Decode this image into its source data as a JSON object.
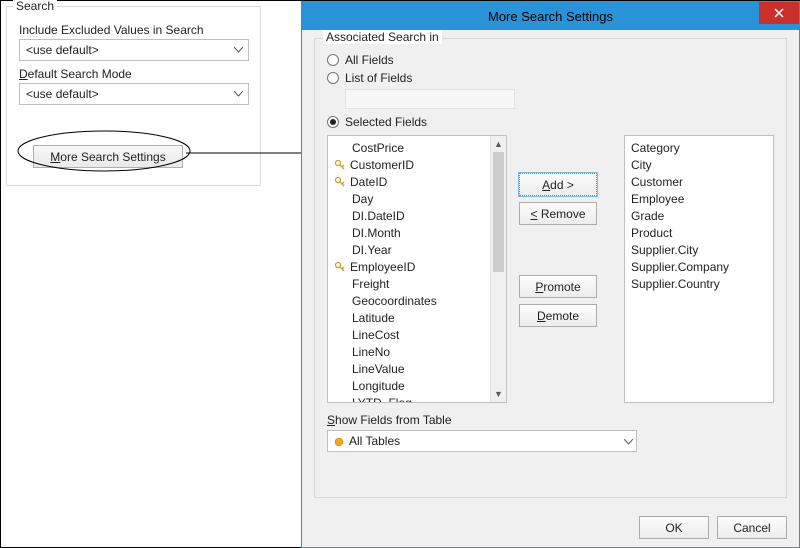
{
  "left": {
    "group_title": "Search",
    "include_label": "Include Excluded Values in Search",
    "include_value": "<use default>",
    "default_mode_label": "Default Search Mode",
    "default_mode_value": "<use default>",
    "more_button": "More Search Settings"
  },
  "dialog": {
    "title": "More Search Settings",
    "assoc_label": "Associated Search in",
    "radio_all": "All Fields",
    "radio_list": "List of Fields",
    "radio_selected": "Selected Fields",
    "available": [
      {
        "label": "CostPrice",
        "key": false
      },
      {
        "label": "CustomerID",
        "key": true
      },
      {
        "label": "DateID",
        "key": true
      },
      {
        "label": "Day",
        "key": false
      },
      {
        "label": "DI.DateID",
        "key": false
      },
      {
        "label": "DI.Month",
        "key": false
      },
      {
        "label": "DI.Year",
        "key": false
      },
      {
        "label": "EmployeeID",
        "key": true
      },
      {
        "label": "Freight",
        "key": false
      },
      {
        "label": "Geocoordinates",
        "key": false
      },
      {
        "label": "Latitude",
        "key": false
      },
      {
        "label": "LineCost",
        "key": false
      },
      {
        "label": "LineNo",
        "key": false
      },
      {
        "label": "LineValue",
        "key": false
      },
      {
        "label": "Longitude",
        "key": false
      },
      {
        "label": "LYTD_Flag",
        "key": false
      }
    ],
    "selected": [
      "Category",
      "City",
      "Customer",
      "Employee",
      "Grade",
      "Product",
      "Supplier.City",
      "Supplier.Company",
      "Supplier.Country"
    ],
    "btn_add": "Add >",
    "btn_remove": "< Remove",
    "btn_promote": "Promote",
    "btn_demote": "Demote",
    "show_label": "Show Fields from Table",
    "table_value": "All Tables",
    "ok": "OK",
    "cancel": "Cancel"
  }
}
